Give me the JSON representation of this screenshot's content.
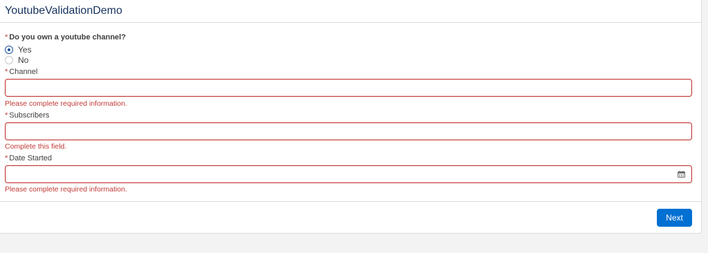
{
  "header": {
    "title": "YoutubeValidationDemo"
  },
  "question": {
    "required_marker": "*",
    "label": "Do you own a youtube channel?",
    "options": [
      {
        "label": "Yes",
        "selected": true
      },
      {
        "label": "No",
        "selected": false
      }
    ]
  },
  "fields": [
    {
      "required_marker": "*",
      "label": "Channel",
      "value": "",
      "error": "Please complete required information."
    },
    {
      "required_marker": "*",
      "label": "Subscribers",
      "value": "",
      "error": "Complete this field."
    },
    {
      "required_marker": "*",
      "label": "Date Started",
      "value": "",
      "error": "Please complete required information.",
      "icon": "calendar-icon"
    }
  ],
  "footer": {
    "next_label": "Next"
  },
  "colors": {
    "accent": "#0070d2",
    "error": "#c23934",
    "title": "#16325c",
    "background": "#f3f3f3"
  }
}
